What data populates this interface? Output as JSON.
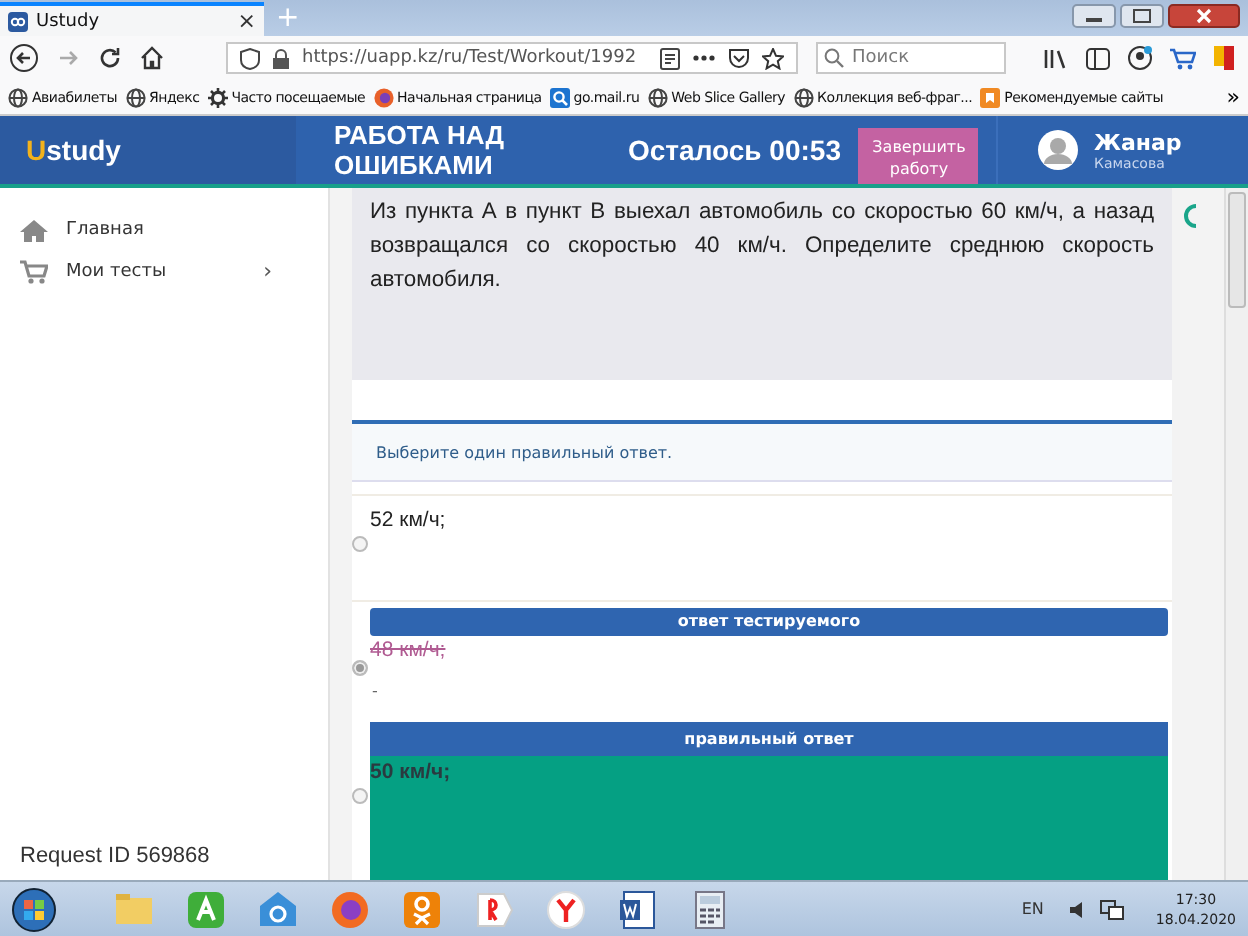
{
  "browser": {
    "tab_title": "Ustudy",
    "tab_close": "×",
    "new_tab": "+",
    "url": "https://uapp.kz/ru/Test/Workout/1992",
    "search_placeholder": "Поиск",
    "bookmarks": [
      {
        "label": "Авиабилеты",
        "kind": "globe"
      },
      {
        "label": "Яндекс",
        "kind": "globe"
      },
      {
        "label": "Часто посещаемые",
        "kind": "gear"
      },
      {
        "label": "Начальная страница",
        "kind": "fox"
      },
      {
        "label": "go.mail.ru",
        "kind": "search"
      },
      {
        "label": "Web Slice Gallery",
        "kind": "globe"
      },
      {
        "label": "Коллекция веб-фраг...",
        "kind": "globe"
      },
      {
        "label": "Рекомендуемые сайты",
        "kind": "flag"
      }
    ],
    "bookmarks_more": "»"
  },
  "header": {
    "logo": "Ustudy",
    "title": "РАБОТА НАД ОШИБКАМИ",
    "timer": "Осталось 00:53",
    "finish_button": "Завершить работу",
    "user_name": "Жанар",
    "user_surname": "Камасова"
  },
  "sidebar": {
    "items": [
      {
        "label": "Главная",
        "kind": "home"
      },
      {
        "label": "Мои тесты",
        "kind": "cart",
        "arrow": "›"
      }
    ],
    "request_id": "Request ID 569868"
  },
  "question": "Из пункта А в пункт В выехал автомобиль со скоростью 60 км/ч, а назад возвращался со скоростью 40 км/ч. Определите среднюю скорость автомобиля.",
  "instruction": "Выберите один правильный ответ.",
  "answers": [
    {
      "kind": "plain",
      "text": "52 км/ч;",
      "selected": false
    },
    {
      "kind": "user",
      "banner": "ответ тестируемого",
      "text": "48 км/ч;",
      "selected": true,
      "note": "-"
    },
    {
      "kind": "correct",
      "banner": "правильный ответ",
      "text": "50 км/ч;",
      "selected": false
    }
  ],
  "taskbar": {
    "lang": "EN",
    "time": "17:30",
    "date": "18.04.2020"
  }
}
